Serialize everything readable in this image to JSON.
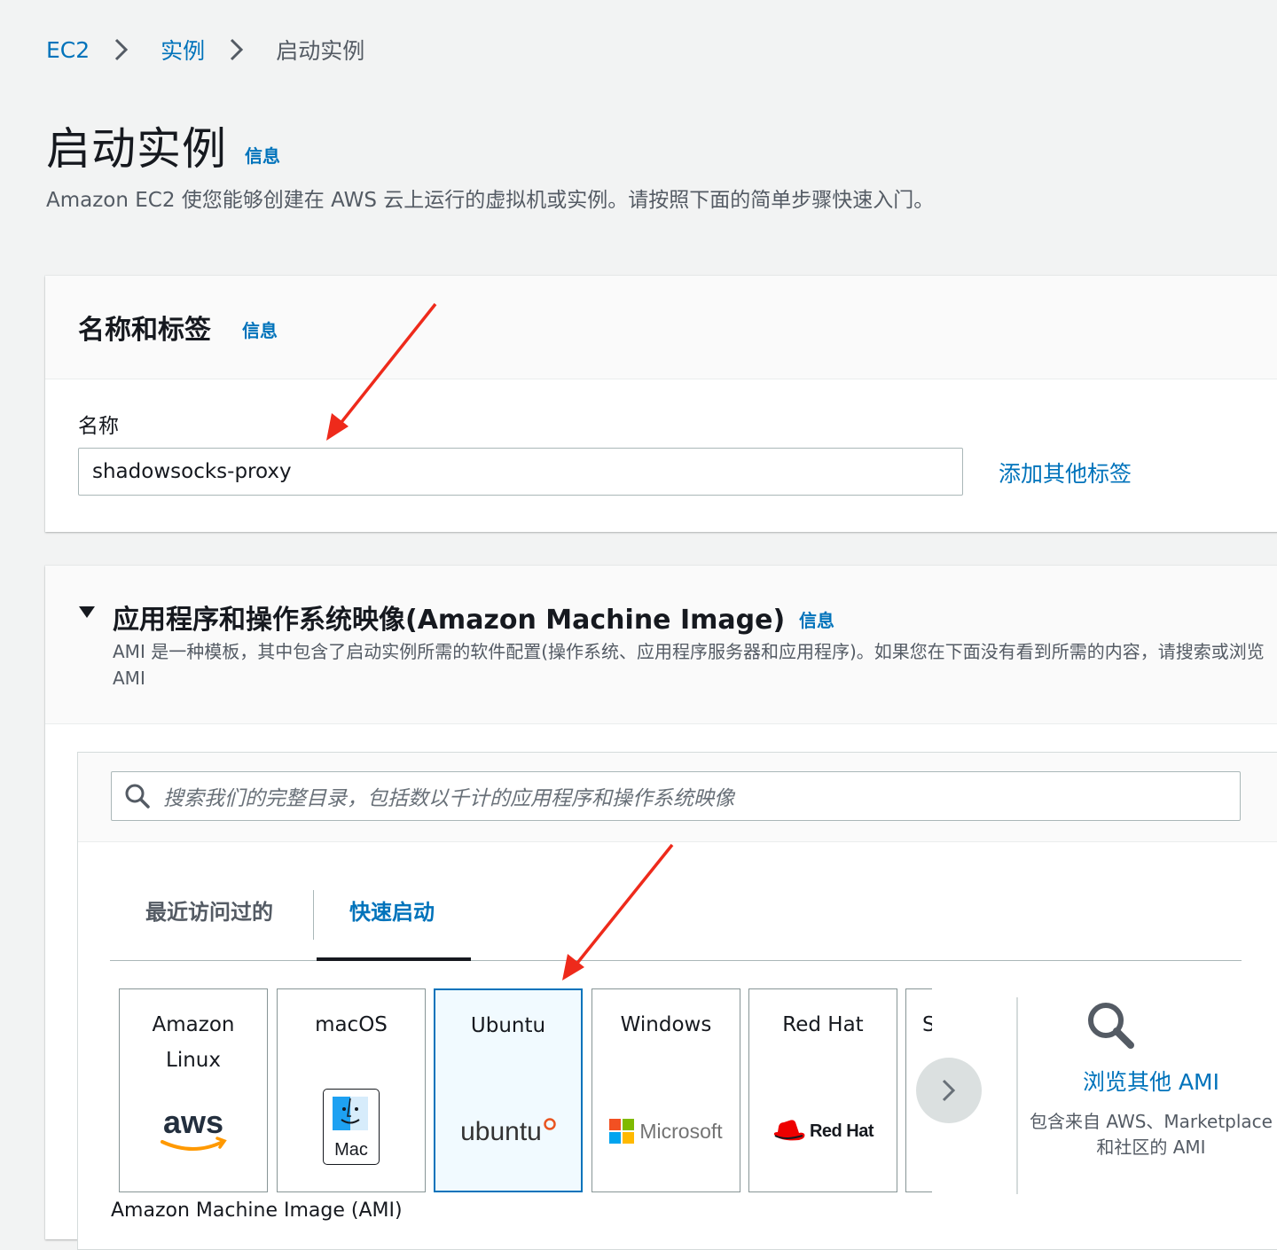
{
  "breadcrumb": {
    "items": [
      "EC2",
      "实例",
      "启动实例"
    ]
  },
  "page": {
    "title": "启动实例",
    "info": "信息",
    "description": "Amazon EC2 使您能够创建在 AWS 云上运行的虚拟机或实例。请按照下面的简单步骤快速入门。"
  },
  "name_tags": {
    "title": "名称和标签",
    "info": "信息",
    "name_label": "名称",
    "name_value": "shadowsocks-proxy",
    "add_tags": "添加其他标签"
  },
  "ami": {
    "title": "应用程序和操作系统映像(Amazon Machine Image)",
    "info": "信息",
    "description": "AMI 是一种模板，其中包含了启动实例所需的软件配置(操作系统、应用程序服务器和应用程序)。如果您在下面没有看到所需的内容，请搜索或浏览 AMI",
    "search_placeholder": "搜索我们的完整目录，包括数以千计的应用程序和操作系统映像",
    "tabs": [
      "最近访问过的",
      "快速启动"
    ],
    "active_tab": "快速启动",
    "cards": [
      {
        "label": "Amazon Linux",
        "logo_text": "aws"
      },
      {
        "label": "macOS",
        "logo_text": "Mac"
      },
      {
        "label": "Ubuntu",
        "logo_text": "ubuntu"
      },
      {
        "label": "Windows",
        "logo_text": "Microsoft"
      },
      {
        "label": "Red Hat",
        "logo_text": "Red Hat"
      },
      {
        "label": "S"
      }
    ],
    "selected_card": "Ubuntu",
    "browse": {
      "title": "浏览其他 AMI",
      "description": "包含来自 AWS、Marketplace 和社区的 AMI"
    },
    "cut_label": "Amazon Machine Image (AMI)"
  },
  "colors": {
    "link": "#0073bb",
    "annotation_arrow": "#ee2a1b",
    "background": "#f2f3f3"
  }
}
